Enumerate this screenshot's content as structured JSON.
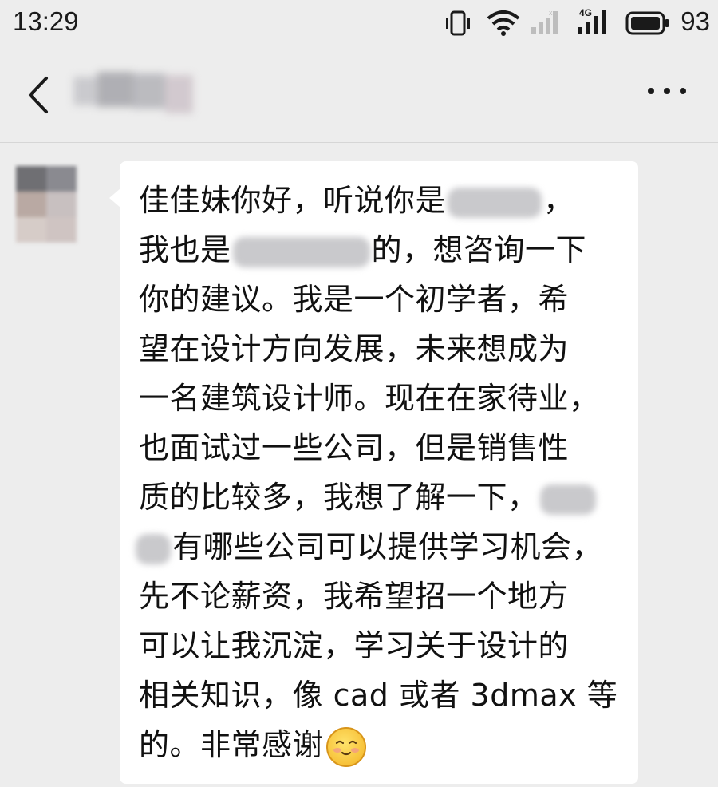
{
  "status_bar": {
    "time": "13:29",
    "battery": "93",
    "network_label": "4G",
    "icons": [
      "vibrate-icon",
      "wifi-icon",
      "signal-icon",
      "signal-4g-icon",
      "battery-icon"
    ]
  },
  "header": {
    "back_icon": "back-arrow-icon",
    "more_icon": "more-icon"
  },
  "message": {
    "sender": "contact",
    "lines": [
      {
        "before": "佳佳妹你好，听说你是",
        "after": "，"
      },
      {
        "before": "我也是",
        "after": "的，想咨询一下"
      },
      {
        "before": "你的建议。我是一个初学者，希",
        "after": ""
      },
      {
        "before": "望在设计方向发展，未来想成为",
        "after": ""
      },
      {
        "before": "一名建筑设计师。现在在家待业，",
        "after": ""
      },
      {
        "before": "也面试过一些公司，但是销售性",
        "after": ""
      },
      {
        "before": "质的比较多，我想了解一下，",
        "after": ""
      },
      {
        "before": "",
        "after": "有哪些公司可以提供学习机会，"
      },
      {
        "before": "先不论薪资，我希望招一个地方",
        "after": ""
      },
      {
        "before": "可以让我沉淀，学习关于设计的",
        "after": ""
      },
      {
        "before": "相关知识，像 cad 或者 3dmax 等",
        "after": ""
      },
      {
        "before": "的。非常感谢",
        "after": ""
      }
    ],
    "emoji": "smiling-face-emoji"
  },
  "colors": {
    "background": "#ededed",
    "bubble": "#ffffff",
    "text": "#111111"
  }
}
